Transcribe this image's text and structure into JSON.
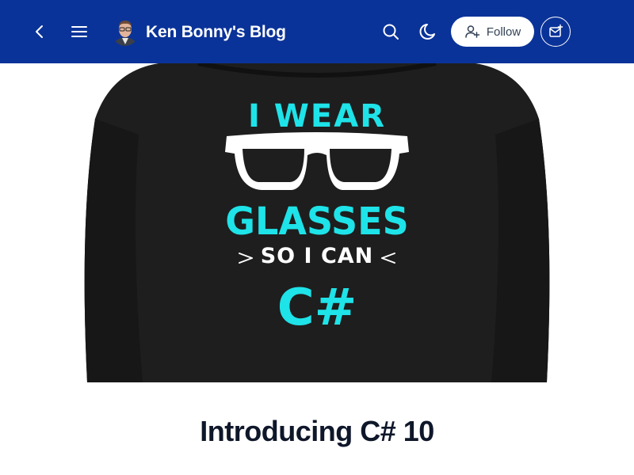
{
  "header": {
    "back_icon": "chevron-left-icon",
    "menu_icon": "hamburger-menu-icon",
    "avatar_icon": "author-avatar",
    "blog_title": "Ken Bonny's Blog",
    "search_icon": "search-icon",
    "theme_icon": "moon-icon",
    "follow_label": "Follow",
    "subscribe_icon": "newsletter-icon",
    "colors": {
      "background": "#0a3399",
      "text": "#ffffff"
    }
  },
  "cover": {
    "shirt_text": {
      "line1": "I WEAR",
      "line2": "GLASSES",
      "line3": "SO I CAN",
      "line4": "C#"
    },
    "colors": {
      "hoodie": "#1e1e1e",
      "text_accent": "#1ee3e8"
    }
  },
  "post": {
    "title": "Introducing C# 10"
  }
}
